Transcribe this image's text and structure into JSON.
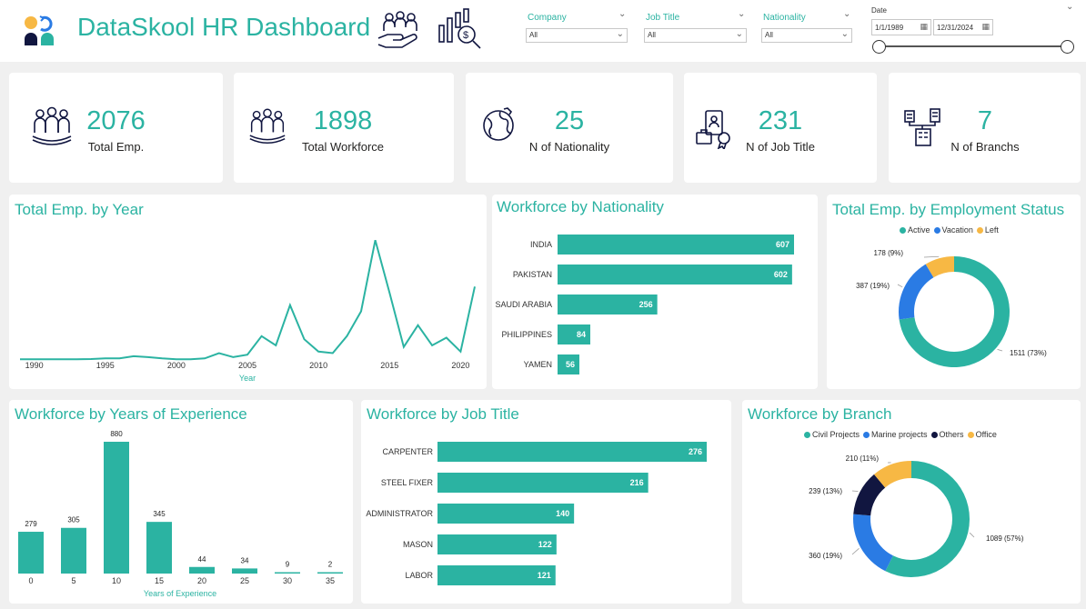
{
  "header": {
    "title": "DataSkool HR Dashboard",
    "filters": [
      {
        "label": "Company",
        "value": "All"
      },
      {
        "label": "Job Title",
        "value": "All"
      },
      {
        "label": "Nationality",
        "value": "All"
      }
    ],
    "date": {
      "label": "Date",
      "start": "1/1/1989",
      "end": "12/31/2024"
    }
  },
  "kpis": [
    {
      "value": "2076",
      "label": "Total Emp.",
      "icon": "people-group-icon"
    },
    {
      "value": "1898",
      "label": "Total Workforce",
      "icon": "people-group-icon"
    },
    {
      "value": "25",
      "label": "N of Nationality",
      "icon": "globe-hand-icon"
    },
    {
      "value": "231",
      "label": "N of Job Title",
      "icon": "id-badge-icon"
    },
    {
      "value": "7",
      "label": "N of Branchs",
      "icon": "buildings-icon"
    }
  ],
  "colors": {
    "teal": "#2bb3a2",
    "blue": "#2a7be4",
    "navy": "#111640",
    "orange": "#f7b844"
  },
  "panels": {
    "by_year": {
      "title": "Total Emp. by Year"
    },
    "by_nationality": {
      "title": "Workforce by Nationality"
    },
    "by_status": {
      "title": "Total Emp. by Employment Status"
    },
    "by_experience": {
      "title": "Workforce by Years of Experience"
    },
    "by_job": {
      "title": "Workforce by Job Title"
    },
    "by_branch": {
      "title": "Workforce by Branch"
    }
  },
  "chart_data": [
    {
      "id": "by_year",
      "type": "line",
      "xlabel": "Year",
      "x_ticks": [
        "1990",
        "1995",
        "2000",
        "2005",
        "2010",
        "2015",
        "2020"
      ],
      "x": [
        1989,
        1990,
        1991,
        1992,
        1993,
        1994,
        1995,
        1996,
        1997,
        1998,
        1999,
        2000,
        2001,
        2002,
        2003,
        2004,
        2005,
        2006,
        2007,
        2008,
        2009,
        2010,
        2011,
        2012,
        2013,
        2014,
        2015,
        2016,
        2017,
        2018,
        2019,
        2020,
        2021
      ],
      "values": [
        5,
        5,
        5,
        5,
        5,
        6,
        8,
        8,
        15,
        12,
        8,
        5,
        5,
        8,
        25,
        12,
        20,
        80,
        50,
        180,
        70,
        30,
        25,
        80,
        160,
        390,
        220,
        45,
        115,
        50,
        75,
        30,
        240
      ],
      "ylim": [
        0,
        420
      ]
    },
    {
      "id": "by_nationality",
      "type": "bar",
      "orientation": "horizontal",
      "categories": [
        "INDIA",
        "PAKISTAN",
        "SAUDI ARABIA",
        "PHILIPPINES",
        "YAMEN"
      ],
      "values": [
        607,
        602,
        256,
        84,
        56
      ]
    },
    {
      "id": "by_status",
      "type": "pie",
      "donut": true,
      "legend": [
        "Active",
        "Vacation",
        "Left"
      ],
      "slices": [
        {
          "name": "Active",
          "value": 1511,
          "label": "1511 (73%)",
          "color": "#2bb3a2"
        },
        {
          "name": "Vacation",
          "value": 387,
          "label": "387 (19%)",
          "color": "#2a7be4"
        },
        {
          "name": "Left",
          "value": 178,
          "label": "178 (9%)",
          "color": "#f7b844"
        }
      ]
    },
    {
      "id": "by_experience",
      "type": "bar",
      "orientation": "vertical",
      "xlabel": "Years of Experience",
      "categories": [
        "0",
        "5",
        "10",
        "15",
        "20",
        "25",
        "30",
        "35"
      ],
      "values": [
        279,
        305,
        880,
        345,
        44,
        34,
        9,
        2
      ]
    },
    {
      "id": "by_job",
      "type": "bar",
      "orientation": "horizontal",
      "categories": [
        "CARPENTER",
        "STEEL FIXER",
        "ADMINISTRATOR",
        "MASON",
        "LABOR"
      ],
      "values": [
        276,
        216,
        140,
        122,
        121
      ]
    },
    {
      "id": "by_branch",
      "type": "pie",
      "donut": true,
      "legend": [
        "Civil Projects",
        "Marine projects",
        "Others",
        "Office"
      ],
      "slices": [
        {
          "name": "Civil Projects",
          "value": 1089,
          "label": "1089 (57%)",
          "color": "#2bb3a2"
        },
        {
          "name": "Marine projects",
          "value": 360,
          "label": "360 (19%)",
          "color": "#2a7be4"
        },
        {
          "name": "Others",
          "value": 239,
          "label": "239 (13%)",
          "color": "#111640"
        },
        {
          "name": "Office",
          "value": 210,
          "label": "210 (11%)",
          "color": "#f7b844"
        }
      ]
    }
  ]
}
